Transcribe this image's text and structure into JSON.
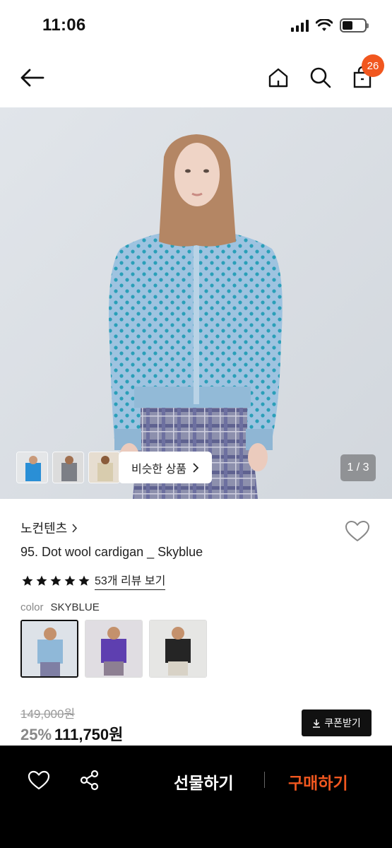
{
  "status_bar": {
    "time": "11:06"
  },
  "nav": {
    "cart_count": "26"
  },
  "hero": {
    "similar_label": "비슷한 상품",
    "page_indicator": "1 / 3"
  },
  "product": {
    "brand": "노컨텐츠",
    "name": "95. Dot wool cardigan _ Skyblue",
    "rating_stars": 5,
    "review_link": "53개 리뷰 보기",
    "color_label": "color",
    "color_value": "SKYBLUE",
    "original_price": "149,000원",
    "discount": "25%",
    "sale_price": "111,750원",
    "coupon_label": "쿠폰받기"
  },
  "bottom_bar": {
    "gift_label": "선물하기",
    "buy_label": "구매하기"
  },
  "colors": {
    "accent": "#f1571f",
    "black": "#000000"
  }
}
